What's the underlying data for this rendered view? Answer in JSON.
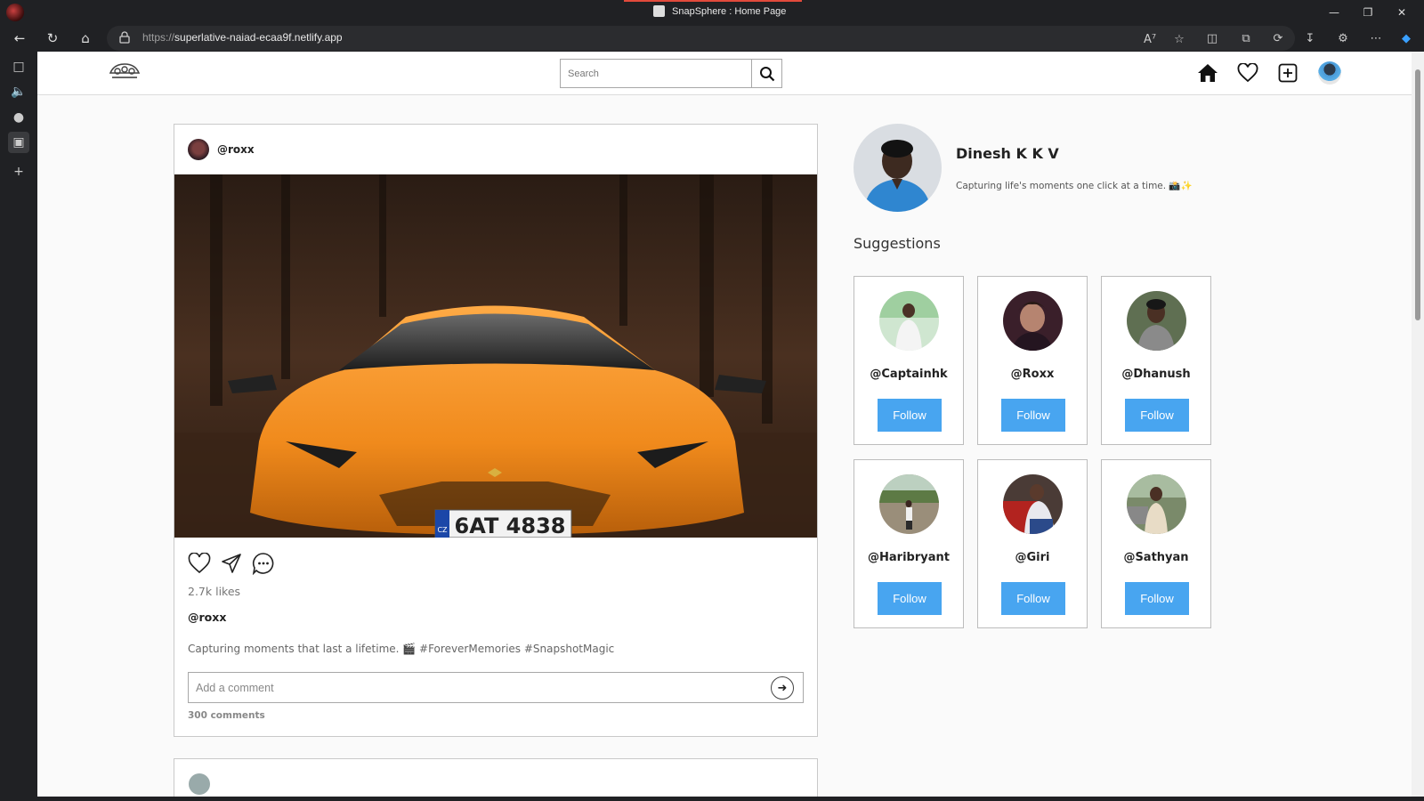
{
  "browser": {
    "tab_title": "SnapSphere : Home Page",
    "url_proto": "https://",
    "url_host": "superlative-naiad-ecaa9f.netlify.app"
  },
  "header": {
    "search_placeholder": "Search"
  },
  "post": {
    "username": "@roxx",
    "plate_text": "6AT 4838",
    "plate_country": "CZ",
    "likes": "2.7k likes",
    "caption_user": "@roxx",
    "caption": "Capturing moments that last a lifetime. 🎬 #ForeverMemories #SnapshotMagic",
    "comment_placeholder": "Add a comment",
    "comments_count": "300 comments"
  },
  "profile": {
    "name": "Dinesh K K V",
    "bio": "Capturing life's moments one click at a time. 📸✨"
  },
  "suggestions": {
    "title": "Suggestions",
    "follow_label": "Follow",
    "users": [
      {
        "name": "@Captainhk"
      },
      {
        "name": "@Roxx"
      },
      {
        "name": "@Dhanush"
      },
      {
        "name": "@Haribryant"
      },
      {
        "name": "@Giri"
      },
      {
        "name": "@Sathyan"
      }
    ]
  },
  "colors": {
    "follow_button": "#48a5f0",
    "accent_tab": "#e24a3b",
    "car_orange": "#f08a1c"
  }
}
